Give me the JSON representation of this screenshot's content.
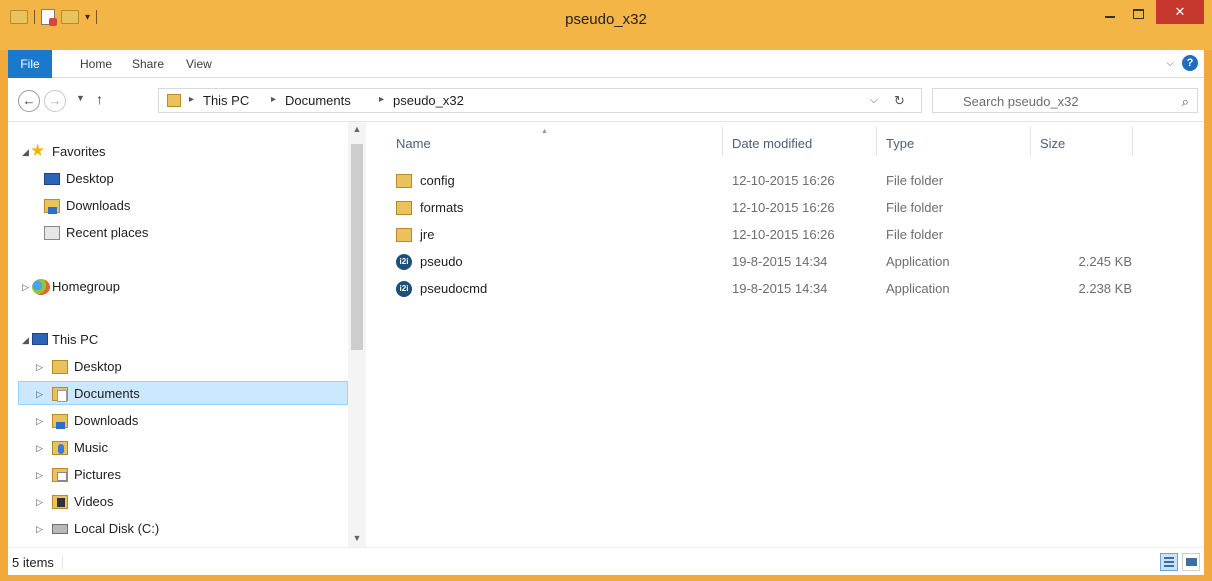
{
  "window": {
    "title": "pseudo_x32"
  },
  "window_buttons": {
    "minimize": "",
    "maximize": "",
    "close": "✕"
  },
  "ribbon": {
    "tabs": [
      {
        "label": "File"
      },
      {
        "label": "Home"
      },
      {
        "label": "Share"
      },
      {
        "label": "View"
      }
    ],
    "help": "?"
  },
  "address": {
    "breadcrumb": [
      "This PC",
      "Documents",
      "pseudo_x32"
    ]
  },
  "search": {
    "placeholder": "Search pseudo_x32"
  },
  "nav_pane": {
    "items": [
      {
        "label": "Favorites"
      },
      {
        "label": "Desktop"
      },
      {
        "label": "Downloads"
      },
      {
        "label": "Recent places"
      },
      {
        "label": "Homegroup"
      },
      {
        "label": "This PC"
      },
      {
        "label": "Desktop"
      },
      {
        "label": "Documents"
      },
      {
        "label": "Downloads"
      },
      {
        "label": "Music"
      },
      {
        "label": "Pictures"
      },
      {
        "label": "Videos"
      },
      {
        "label": "Local Disk (C:)"
      }
    ]
  },
  "file_list": {
    "columns": [
      "Name",
      "Date modified",
      "Type",
      "Size"
    ],
    "rows": [
      {
        "name": "config",
        "date": "12-10-2015 16:26",
        "type": "File folder",
        "size": "",
        "icon": "folder-icon"
      },
      {
        "name": "formats",
        "date": "12-10-2015 16:26",
        "type": "File folder",
        "size": "",
        "icon": "folder-icon"
      },
      {
        "name": "jre",
        "date": "12-10-2015 16:26",
        "type": "File folder",
        "size": "",
        "icon": "folder-icon"
      },
      {
        "name": "pseudo",
        "date": "19-8-2015 14:34",
        "type": "Application",
        "size": "2.245 KB",
        "icon": "application-icon"
      },
      {
        "name": "pseudocmd",
        "date": "19-8-2015 14:34",
        "type": "Application",
        "size": "2.238 KB",
        "icon": "application-icon"
      }
    ],
    "app_icon_text": "i2i"
  },
  "status_bar": {
    "item_count": "5 items"
  },
  "colors": {
    "title_bar": "#f4b547",
    "file_tab": "#1979ca",
    "close_button": "#c6372e",
    "selection": "#cce8ff"
  }
}
